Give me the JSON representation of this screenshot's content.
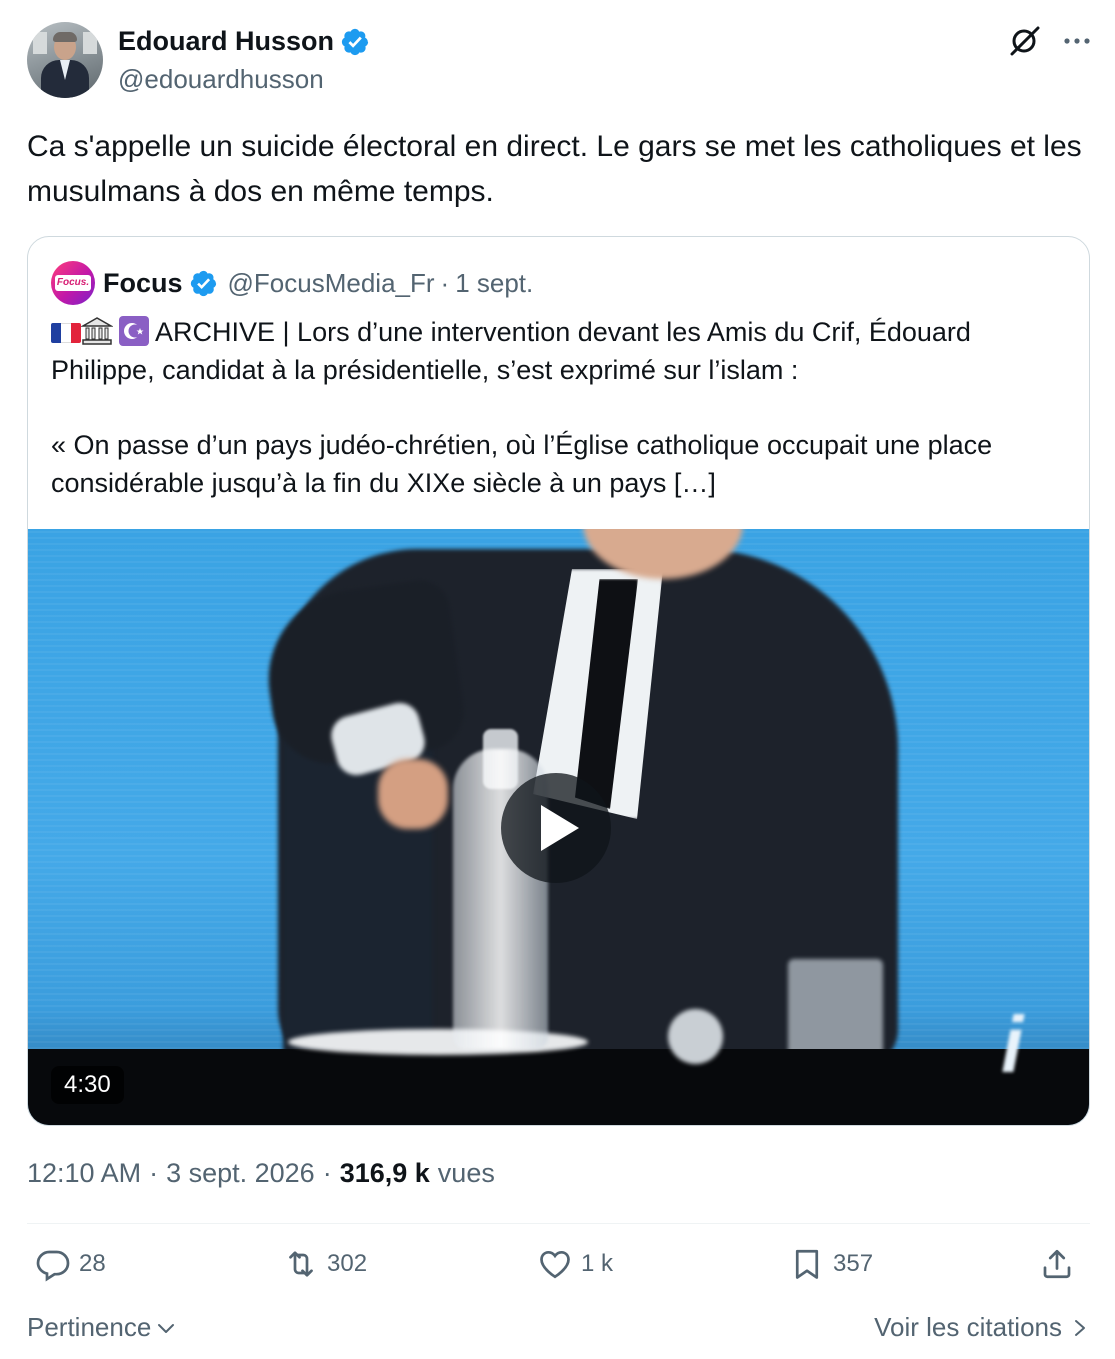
{
  "author": {
    "name": "Edouard Husson",
    "handle": "@edouardhusson",
    "verified": true
  },
  "icons": {
    "verified": "verified-badge-icon",
    "grok": "grok-icon",
    "more": "more-icon",
    "play": "play-icon",
    "reply": "reply-icon",
    "retweet": "retweet-icon",
    "like": "like-icon",
    "bookmark": "bookmark-icon",
    "share": "share-icon",
    "chevron_down": "chevron-down-icon",
    "chevron_right": "chevron-right-icon"
  },
  "tweet": {
    "text": "Ca s'appelle un suicide électoral en direct. Le gars se met les catholiques et les musulmans à dos en même temps."
  },
  "quote": {
    "name": "Focus",
    "avatar_label": "Focus.",
    "handle": "@FocusMedia_Fr",
    "separator": "·",
    "date": "1 sept.",
    "line1": "ARCHIVE | Lors d’une intervention devant les Amis du Crif, Édouard Philippe, candidat à la présidentielle, s’est exprimé sur l’islam :",
    "line2": "« On passe d’un pays judéo-chrétien, où l’Église catholique occupait une place considérable jusqu’à la fin du XIXe siècle à un pays […]",
    "video": {
      "duration": "4:30",
      "logo_glyph": "i"
    }
  },
  "meta": {
    "time": "12:10 AM",
    "dot1": "·",
    "date": "3 sept. 2026",
    "dot2": "·",
    "views": "316,9 k",
    "views_label": "vues"
  },
  "actions": {
    "replies": "28",
    "retweets": "302",
    "likes": "1 k",
    "bookmarks": "357"
  },
  "footer": {
    "sort_label": "Pertinence",
    "quotes_link": "Voir les citations"
  },
  "colors": {
    "verified": "#1d9bf0",
    "text_primary": "#0f1419",
    "text_secondary": "#536471",
    "border": "#cfd9de"
  }
}
